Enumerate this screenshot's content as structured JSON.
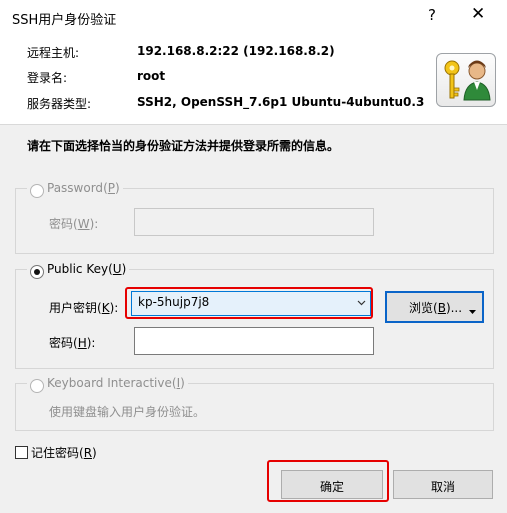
{
  "window": {
    "title": "SSH用户身份验证",
    "help_label": "?",
    "close_label": "✕"
  },
  "header": {
    "host_label": "远程主机:",
    "host_value": "192.168.8.2:22 (192.168.8.2)",
    "login_label": "登录名:",
    "login_value": "root",
    "server_label": "服务器类型:",
    "server_value": "SSH2, OpenSSH_7.6p1 Ubuntu-4ubuntu0.3"
  },
  "instruction": "请在下面选择恰当的身份验证方法并提供登录所需的信息。",
  "password_group": {
    "radio_label": "Password",
    "hotkey": "P",
    "field_label": "密码",
    "field_hotkey": "W"
  },
  "publickey_group": {
    "radio_label": "Public Key",
    "hotkey": "U",
    "key_label": "用户密钥",
    "key_hotkey": "K",
    "key_value": "kp-5hujp7j8",
    "browse_label": "浏览",
    "browse_hotkey": "B",
    "passphrase_label": "密码",
    "passphrase_hotkey": "H",
    "passphrase_value": ""
  },
  "keyboard_group": {
    "radio_label": "Keyboard Interactive",
    "hotkey": "I",
    "description": "使用键盘输入用户身份验证。"
  },
  "remember": {
    "label": "记住密码",
    "hotkey": "R"
  },
  "buttons": {
    "ok_label": "确定",
    "cancel_label": "取消"
  },
  "colors": {
    "highlight_red": "#e60000",
    "focus_blue": "#0a64c8"
  }
}
